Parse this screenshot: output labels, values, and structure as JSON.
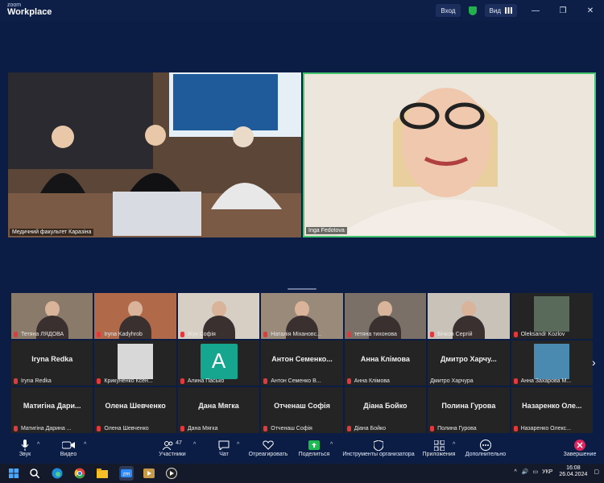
{
  "app": {
    "brand_top": "zoom",
    "brand_name": "Workplace"
  },
  "titlebar": {
    "signin_label": "Вход",
    "view_label": "Вид",
    "minimize": "—",
    "restore": "❐",
    "close": "✕"
  },
  "main_videos": [
    {
      "name": "Медичний факультет Каразіна"
    },
    {
      "name": "Inga Fedotova"
    }
  ],
  "gallery": [
    {
      "name": "Тетяна ЛЯДОВА",
      "muted": true,
      "type": "video",
      "bg": "#8a7a6a"
    },
    {
      "name": "Iryna Kadyhrob",
      "muted": true,
      "type": "video",
      "bg": "#b06a4a"
    },
    {
      "name": "Жук Софія",
      "muted": true,
      "type": "video",
      "bg": "#d8cfc4"
    },
    {
      "name": "Наталія Міхановс...",
      "muted": true,
      "type": "video",
      "bg": "#9a8a7a"
    },
    {
      "name": "тетяна тихонова",
      "muted": true,
      "type": "video",
      "bg": "#7a7068"
    },
    {
      "name": "Бічков Сергій",
      "muted": true,
      "type": "video",
      "bg": "#c9c2b8"
    },
    {
      "name": "Oleksandr Kozlov",
      "muted": true,
      "type": "photo",
      "bg": "#5a6a5a"
    },
    {
      "name": "Iryna Redka",
      "muted": true,
      "type": "name",
      "center": "Iryna Redka"
    },
    {
      "name": "Крикуненко Ксен...",
      "muted": true,
      "type": "photo",
      "bg": "#d8d8d8"
    },
    {
      "name": "Алина Пасько",
      "muted": true,
      "type": "avatar",
      "letter": "A"
    },
    {
      "name": "Антон Семенко В...",
      "muted": true,
      "type": "name",
      "center": "Антон  Семенко..."
    },
    {
      "name": "Анна Клімова",
      "muted": true,
      "type": "name",
      "center": "Анна Клімова"
    },
    {
      "name": "Дмитро Харчура",
      "muted": false,
      "type": "name",
      "center": "Дмитро  Харчу..."
    },
    {
      "name": "Анна Захарова М...",
      "muted": true,
      "type": "photo",
      "bg": "#4a8ab0"
    },
    {
      "name": "Матигіна Дарина ...",
      "muted": true,
      "type": "name",
      "center": "Матигіна  Дари..."
    },
    {
      "name": "Олена Шевченко",
      "muted": true,
      "type": "name",
      "center": "Олена Шевченко"
    },
    {
      "name": "Дана Мягка",
      "muted": true,
      "type": "name",
      "center": "Дана Мягка"
    },
    {
      "name": "Отченаш Софія",
      "muted": true,
      "type": "name",
      "center": "Отченаш Софія"
    },
    {
      "name": "Діана Бойко",
      "muted": true,
      "type": "name",
      "center": "Діана Бойко"
    },
    {
      "name": "Полина Гурова",
      "muted": true,
      "type": "name",
      "center": "Полина Гурова"
    },
    {
      "name": "Назаренко Олекс...",
      "muted": true,
      "type": "name",
      "center": "Назаренко  Оле..."
    }
  ],
  "toolbar": {
    "audio": "Звук",
    "video": "Видео",
    "participants": "Участники",
    "participants_count": "47",
    "chat": "Чат",
    "react": "Отреагировать",
    "share": "Поделиться",
    "host_tools": "Инструменты организатора",
    "apps": "Приложения",
    "more": "Дополнительно",
    "end": "Завершение"
  },
  "taskbar": {
    "lang": "УКР",
    "time": "16:08",
    "date": "26.04.2024"
  },
  "colors": {
    "bg": "#0b1d44",
    "active_border": "#43c46f",
    "muted": "#e0393e",
    "share": "#1fb954",
    "end": "#e0245e"
  }
}
